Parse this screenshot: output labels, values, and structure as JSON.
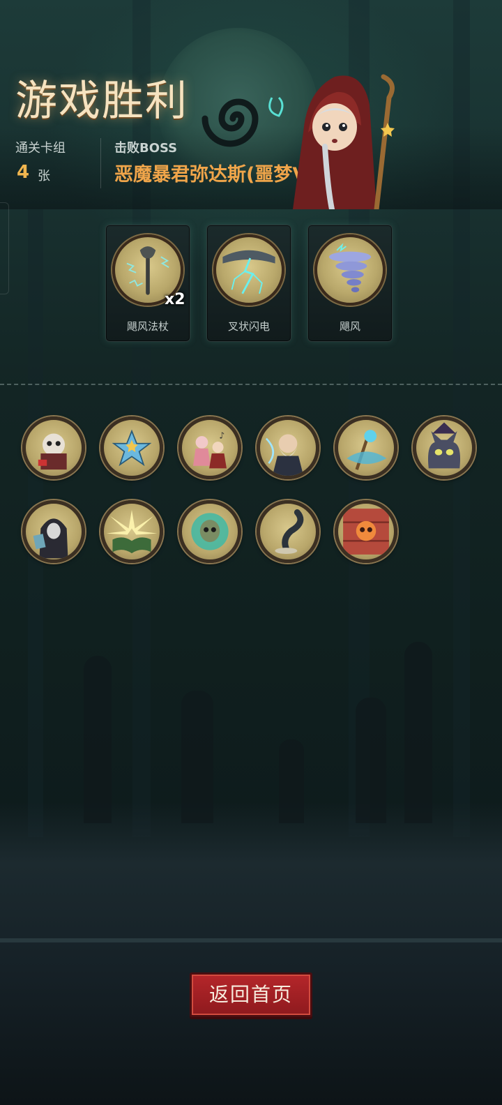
{
  "header": {
    "title": "游戏胜利",
    "cleared_deck_label": "通关卡组",
    "cleared_deck_count": "4",
    "cleared_deck_unit": "张",
    "defeated_label": "击败BOSS",
    "boss_name": "恶魔暴君弥达斯(噩梦V)"
  },
  "cards": [
    {
      "name": "飓风法杖",
      "count": "x2",
      "icon": "staff-icon"
    },
    {
      "name": "叉状闪电",
      "count": "",
      "icon": "lightning-icon"
    },
    {
      "name": "飓风",
      "count": "",
      "icon": "tornado-icon"
    }
  ],
  "relics_row1": [
    {
      "icon": "masked-merchant-icon"
    },
    {
      "icon": "blue-star-icon"
    },
    {
      "icon": "musicians-icon"
    },
    {
      "icon": "old-sage-icon"
    },
    {
      "icon": "water-orb-staff-icon"
    },
    {
      "icon": "witch-cat-icon"
    }
  ],
  "relics_row2": [
    {
      "icon": "hooded-cardmaster-icon"
    },
    {
      "icon": "glowing-book-icon"
    },
    {
      "icon": "cursed-skull-icon"
    },
    {
      "icon": "dark-tornado-icon"
    },
    {
      "icon": "skull-barrel-icon"
    }
  ],
  "footer": {
    "home_button": "返回首页"
  },
  "colors": {
    "title_glow": "#f6e3c0",
    "accent_orange": "#f0a54a",
    "button_red": "#b5262a"
  }
}
